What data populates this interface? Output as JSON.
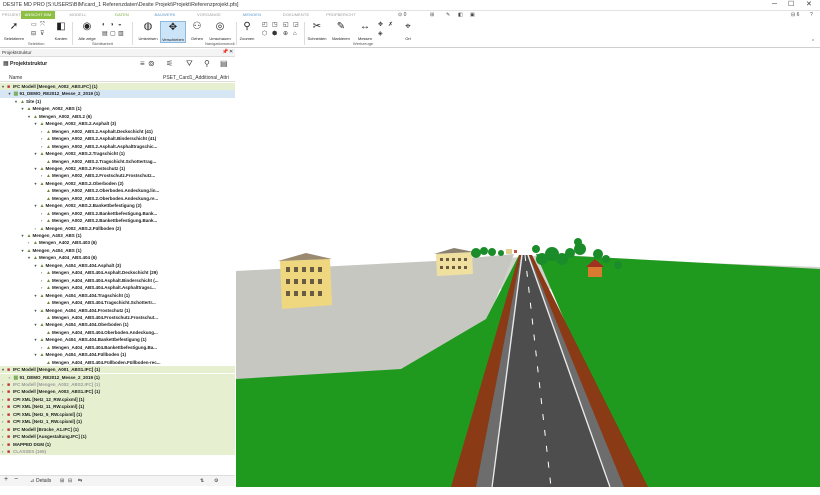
{
  "window": {
    "title": "DESITE MD PRO [S:\\USERS\\BIM\\card_1 Referenzdaten\\Desite Projekt\\Projekt\\Referenzprojekt.pfs]",
    "controls": [
      "─",
      "☐",
      "✕"
    ]
  },
  "tabs": [
    {
      "label": "PROJEKT",
      "style": "plain"
    },
    {
      "label": "ANSICHT BIM",
      "style": "active"
    },
    {
      "label": "MODELL",
      "style": "plain"
    },
    {
      "label": "DATEN",
      "style": "ctx"
    },
    {
      "label": "BAUWERK",
      "style": "ctxb"
    },
    {
      "label": "VORGÄNGE",
      "style": "plain"
    },
    {
      "label": "MENGEN",
      "style": "ctxb"
    },
    {
      "label": "DOKUMENTE",
      "style": "plain"
    },
    {
      "label": "PRÜFBERICHT",
      "style": "plain"
    }
  ],
  "quick": {
    "zoom": "0",
    "page": "6"
  },
  "ribbon": {
    "buttons": [
      {
        "label": "Selektieren",
        "icon": "cursor-icon",
        "glyph": "➚"
      },
      {
        "label": "Kanten",
        "icon": "edges-icon",
        "glyph": "◧"
      },
      {
        "label": "Alle zeige",
        "icon": "show-all-icon",
        "glyph": "◉"
      },
      {
        "label": "Umkreisen",
        "icon": "orbit-icon",
        "glyph": "◍"
      },
      {
        "label": "Verschieben",
        "icon": "pan-icon",
        "glyph": "✥"
      },
      {
        "label": "Gehen",
        "icon": "walk-icon",
        "glyph": "⚇"
      },
      {
        "label": "Umschauen",
        "icon": "look-around-icon",
        "glyph": "◎"
      },
      {
        "label": "Zoomen",
        "icon": "zoom-icon",
        "glyph": "⚲"
      },
      {
        "label": "Schneiden",
        "icon": "cut-icon",
        "glyph": "✂"
      },
      {
        "label": "Markieren",
        "icon": "marker-icon",
        "glyph": "✎"
      },
      {
        "label": "Messen",
        "icon": "measure-icon",
        "glyph": "↔"
      },
      {
        "label": "Ort",
        "icon": "location-icon",
        "glyph": "⌖"
      }
    ],
    "groups": [
      {
        "label": "Selektion"
      },
      {
        "label": "Sichtbarkeit"
      },
      {
        "label": "Navigationsmodi"
      },
      {
        "label": "Werkzeuge"
      }
    ]
  },
  "panel": {
    "header": "Projektstruktur",
    "pin": "📌",
    "close": "✕",
    "title": "Projektstruktur",
    "columns": [
      "Name",
      "PSET_Card1_Additional_Attri"
    ]
  },
  "tree": [
    {
      "text": "IFC Modell [Mengen_A002_ABS.IFC] (1)",
      "lvl": 0,
      "ar": "▾",
      "ic": "■",
      "bg": "hl"
    },
    {
      "text": "91_DEMO_RE2012_Messe_2_2019 (1)",
      "lvl": 1,
      "ar": "▾",
      "ic": "▦",
      "bg": "sel"
    },
    {
      "text": "Site (1)",
      "lvl": 2,
      "ar": "▾",
      "ic": "▲",
      "bg": ""
    },
    {
      "text": "Mengen_A002_ABS (1)",
      "lvl": 3,
      "ar": "▾",
      "ic": "▲",
      "bg": ""
    },
    {
      "text": "Mengen_A002_ABS.2 (6)",
      "lvl": 4,
      "ar": "▾",
      "ic": "▲",
      "bg": ""
    },
    {
      "text": "Mengen_A002_ABS.2.Asphalt (3)",
      "lvl": 5,
      "ar": "▾",
      "ic": "▲",
      "bg": ""
    },
    {
      "text": "Mengen_A002_ABS.2.Asphalt.Deckschicht (41)",
      "lvl": 6,
      "ar": "›",
      "ic": "▲",
      "bg": ""
    },
    {
      "text": "Mengen_A002_ABS.2.Asphalt.Binderschicht (41)",
      "lvl": 6,
      "ar": "›",
      "ic": "▲",
      "bg": ""
    },
    {
      "text": "Mengen_A002_ABS.2.Asphalt.Asphalttragschic...",
      "lvl": 6,
      "ar": "›",
      "ic": "▲",
      "bg": ""
    },
    {
      "text": "Mengen_A002_ABS.2.Tragschicht (1)",
      "lvl": 5,
      "ar": "▾",
      "ic": "▲",
      "bg": ""
    },
    {
      "text": "Mengen_A002_ABS.2.Tragschicht.Schottertrag...",
      "lvl": 6,
      "ar": "",
      "ic": "▲",
      "bg": ""
    },
    {
      "text": "Mengen_A002_ABS.2.Frostschutz (1)",
      "lvl": 5,
      "ar": "▾",
      "ic": "▲",
      "bg": ""
    },
    {
      "text": "Mengen_A002_ABS.2.Frostschutz.Frostschutz...",
      "lvl": 6,
      "ar": "›",
      "ic": "▲",
      "bg": ""
    },
    {
      "text": "Mengen_A002_ABS.2.Oberboden (2)",
      "lvl": 5,
      "ar": "▾",
      "ic": "▲",
      "bg": ""
    },
    {
      "text": "Mengen_A002_ABS.2.Oberboden.Andeckung.lin...",
      "lvl": 6,
      "ar": "",
      "ic": "▲",
      "bg": ""
    },
    {
      "text": "Mengen_A002_ABS.2.Oberboden.Andeckung.re...",
      "lvl": 6,
      "ar": "",
      "ic": "▲",
      "bg": ""
    },
    {
      "text": "Mengen_A002_ABS.2.Bankettbefestigung (2)",
      "lvl": 5,
      "ar": "▾",
      "ic": "▲",
      "bg": ""
    },
    {
      "text": "Mengen_A002_ABS.2.Bankettbefestigung.Bank...",
      "lvl": 6,
      "ar": "›",
      "ic": "▲",
      "bg": ""
    },
    {
      "text": "Mengen_A002_ABS.2.Bankettbefestigung.Bank...",
      "lvl": 6,
      "ar": "›",
      "ic": "▲",
      "bg": ""
    },
    {
      "text": "Mengen_A002_ABS.2.Füllboden (2)",
      "lvl": 5,
      "ar": "›",
      "ic": "▲",
      "bg": ""
    },
    {
      "text": "Mengen_A403_ABS (1)",
      "lvl": 3,
      "ar": "▾",
      "ic": "▲",
      "bg": ""
    },
    {
      "text": "Mengen_A402_ABS.403 (6)",
      "lvl": 4,
      "ar": "›",
      "ic": "▲",
      "bg": ""
    },
    {
      "text": "Mengen_A404_ABS (1)",
      "lvl": 3,
      "ar": "▾",
      "ic": "▲",
      "bg": ""
    },
    {
      "text": "Mengen_A404_ABS.404 (6)",
      "lvl": 4,
      "ar": "▾",
      "ic": "▲",
      "bg": ""
    },
    {
      "text": "Mengen_A404_ABS.404.Asphalt (3)",
      "lvl": 5,
      "ar": "▾",
      "ic": "▲",
      "bg": ""
    },
    {
      "text": "Mengen_A404_ABS.404.Asphalt.Deckschicht (29)",
      "lvl": 6,
      "ar": "›",
      "ic": "▲",
      "bg": ""
    },
    {
      "text": "Mengen_A404_ABS.404.Asphalt.Binderschicht (...",
      "lvl": 6,
      "ar": "›",
      "ic": "▲",
      "bg": ""
    },
    {
      "text": "Mengen_A404_ABS.404.Asphalt.Asphalttragsc...",
      "lvl": 6,
      "ar": "›",
      "ic": "▲",
      "bg": ""
    },
    {
      "text": "Mengen_A404_ABS.404.Tragschicht (1)",
      "lvl": 5,
      "ar": "▾",
      "ic": "▲",
      "bg": ""
    },
    {
      "text": "Mengen_A404_ABS.404.Tragschicht.Schottertr...",
      "lvl": 6,
      "ar": "",
      "ic": "▲",
      "bg": ""
    },
    {
      "text": "Mengen_A404_ABS.404.Frostschutz (1)",
      "lvl": 5,
      "ar": "▾",
      "ic": "▲",
      "bg": ""
    },
    {
      "text": "Mengen_A404_ABS.404.Frostschutz.Frostschut...",
      "lvl": 6,
      "ar": "",
      "ic": "▲",
      "bg": ""
    },
    {
      "text": "Mengen_A404_ABS.404.Oberboden (1)",
      "lvl": 5,
      "ar": "▾",
      "ic": "▲",
      "bg": ""
    },
    {
      "text": "Mengen_A404_ABS.404.Oberboden.Andeckung...",
      "lvl": 6,
      "ar": "",
      "ic": "▲",
      "bg": ""
    },
    {
      "text": "Mengen_A404_ABS.404.Bankettbefestigung (1)",
      "lvl": 5,
      "ar": "▾",
      "ic": "▲",
      "bg": ""
    },
    {
      "text": "Mengen_A404_ABS.404.Bankettbefestigung.Ba...",
      "lvl": 6,
      "ar": "›",
      "ic": "▲",
      "bg": ""
    },
    {
      "text": "Mengen_A404_ABS.404.Füllboden (1)",
      "lvl": 5,
      "ar": "▾",
      "ic": "▲",
      "bg": ""
    },
    {
      "text": "Mengen_A404_ABS.404.Füllboden.Füllboden-rec...",
      "lvl": 6,
      "ar": "",
      "ic": "▲",
      "bg": ""
    },
    {
      "text": "IFC Modell [Mengen_A001_ABS1.IFC] (1)",
      "lvl": 0,
      "ar": "▾",
      "ic": "■",
      "bg": "hl"
    },
    {
      "text": "91_DEMO_RE2012_Messe_2_2019 (1)",
      "lvl": 1,
      "ar": "›",
      "ic": "▦",
      "bg": "hl"
    },
    {
      "text": "IFC Modell [Mengen_A002_ABS2.IFC] (1)",
      "lvl": 0,
      "ar": "›",
      "ic": "■",
      "bg": "hl",
      "grey": true
    },
    {
      "text": "IFC Modell [Mengen_A003_ABS1.IFC] (1)",
      "lvl": 0,
      "ar": "›",
      "ic": "■",
      "bg": "hl"
    },
    {
      "text": "CPI XML [Netz_12_RW.cpixml] (1)",
      "lvl": 0,
      "ar": "›",
      "ic": "■",
      "bg": "hl"
    },
    {
      "text": "CPI XML [Netz_11_RW.cpixml] (1)",
      "lvl": 0,
      "ar": "›",
      "ic": "■",
      "bg": "hl"
    },
    {
      "text": "CPI XML [Netz_5_RW.cpixml] (1)",
      "lvl": 0,
      "ar": "›",
      "ic": "■",
      "bg": "hl"
    },
    {
      "text": "CPI XML [Netz_1_RW.cpixml] (1)",
      "lvl": 0,
      "ar": "›",
      "ic": "■",
      "bg": "hl"
    },
    {
      "text": "IFC Modell [Brücke_A1.IFC] (1)",
      "lvl": 0,
      "ar": "›",
      "ic": "■",
      "bg": "hl"
    },
    {
      "text": "IFC Modell [Ausgestaltung.IFC] (1)",
      "lvl": 0,
      "ar": "›",
      "ic": "■",
      "bg": "hl"
    },
    {
      "text": "MAPPED DGM (1)",
      "lvl": 0,
      "ar": "›",
      "ic": "■",
      "bg": "hl"
    },
    {
      "text": "CLASSES (165)",
      "lvl": 0,
      "ar": "›",
      "ic": "■",
      "bg": "hl",
      "grey": true
    }
  ],
  "bottom": {
    "add": "+",
    "remove": "−",
    "details": "Details"
  },
  "colors": {
    "accent": "#8cbf44",
    "row_highlight": "#e6efcf",
    "grass": "#1f9a1f",
    "road": "#4d4d4d",
    "embankment": "#8a3a14"
  }
}
